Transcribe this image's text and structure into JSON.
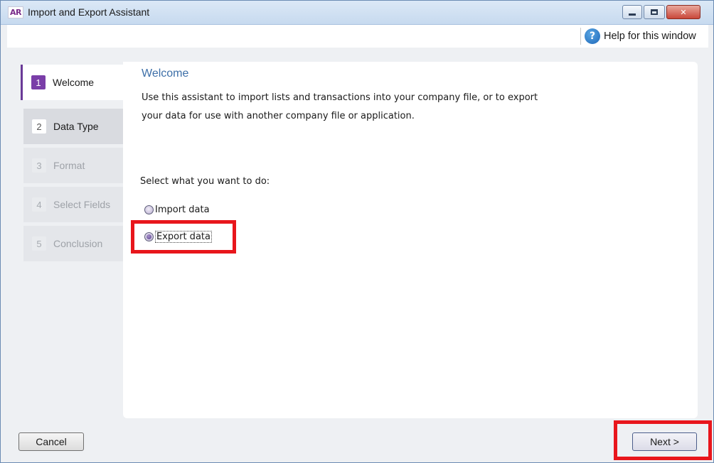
{
  "window": {
    "logo": "AR",
    "title": "Import and Export Assistant",
    "controls": {
      "minimize": "minimize",
      "maximize": "maximize",
      "close": "✕"
    }
  },
  "help": {
    "label": "Help for this window",
    "icon": "?"
  },
  "steps": [
    {
      "num": "1",
      "label": "Welcome",
      "state": "active"
    },
    {
      "num": "2",
      "label": "Data Type",
      "state": "enabled"
    },
    {
      "num": "3",
      "label": "Format",
      "state": "disabled"
    },
    {
      "num": "4",
      "label": "Select Fields",
      "state": "disabled"
    },
    {
      "num": "5",
      "label": "Conclusion",
      "state": "disabled"
    }
  ],
  "content": {
    "heading": "Welcome",
    "intro_line1": "Use this assistant to import lists and transactions into your company file, or to export",
    "intro_line2": "your data for use with another company file or application.",
    "select_label": "Select what you want to do:",
    "options": [
      {
        "label": "Import data",
        "checked": false
      },
      {
        "label": "Export data",
        "checked": true
      }
    ]
  },
  "buttons": {
    "cancel": "Cancel",
    "next": "Next >"
  },
  "colors": {
    "accent": "#7a3ea8",
    "heading": "#3d6fa8",
    "highlight": "#e8161c"
  }
}
